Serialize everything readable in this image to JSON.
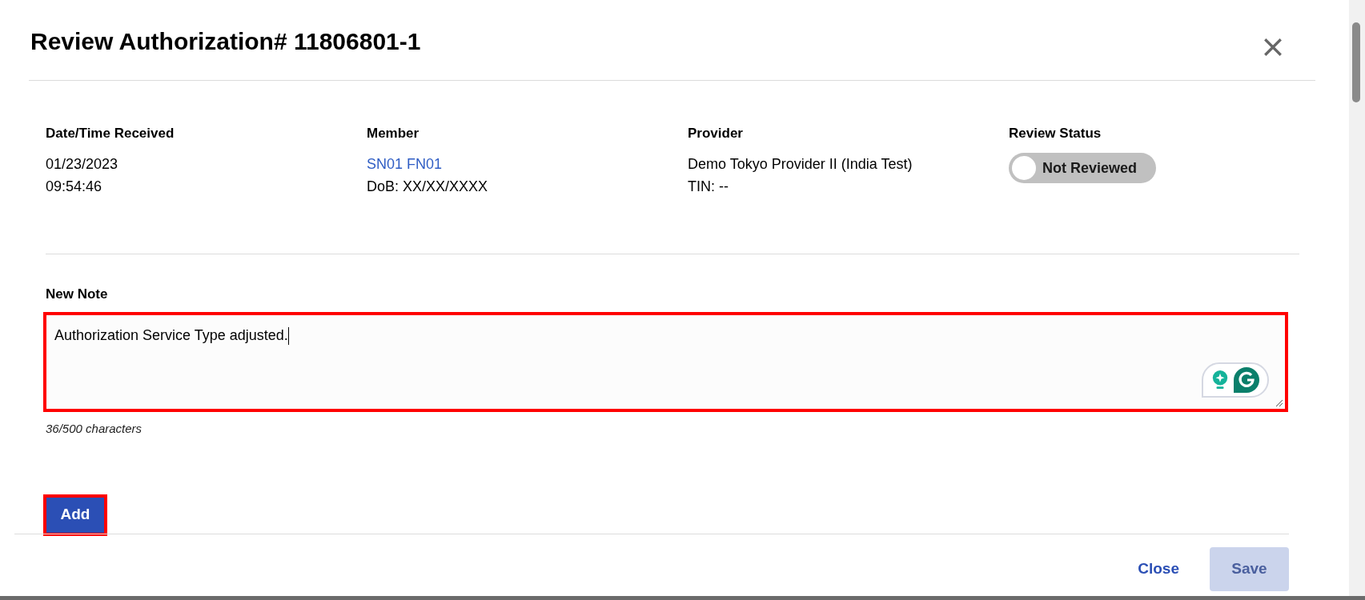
{
  "dialog": {
    "title": "Review Authorization# 11806801-1"
  },
  "details": [
    {
      "kind": "text",
      "label": "Date/Time Received",
      "lines": [
        "01/23/2023",
        "09:54:46"
      ]
    },
    {
      "kind": "member",
      "label": "Member",
      "link": "SN01 FN01",
      "lines": [
        "DoB: XX/XX/XXXX"
      ]
    },
    {
      "kind": "text",
      "label": "Provider",
      "lines": [
        "Demo Tokyo Provider II (India Test)",
        "TIN: --"
      ]
    },
    {
      "kind": "toggle",
      "label": "Review Status",
      "toggle": {
        "label": "Not Reviewed",
        "on": false
      }
    }
  ],
  "note": {
    "label": "New Note",
    "value": "Authorization Service Type adjusted.",
    "counter": "36/500 characters",
    "highlighted": true
  },
  "add_button": {
    "label": "Add",
    "highlighted": true
  },
  "footer": {
    "close": "Close",
    "save": {
      "label": "Save",
      "disabled": true
    }
  }
}
